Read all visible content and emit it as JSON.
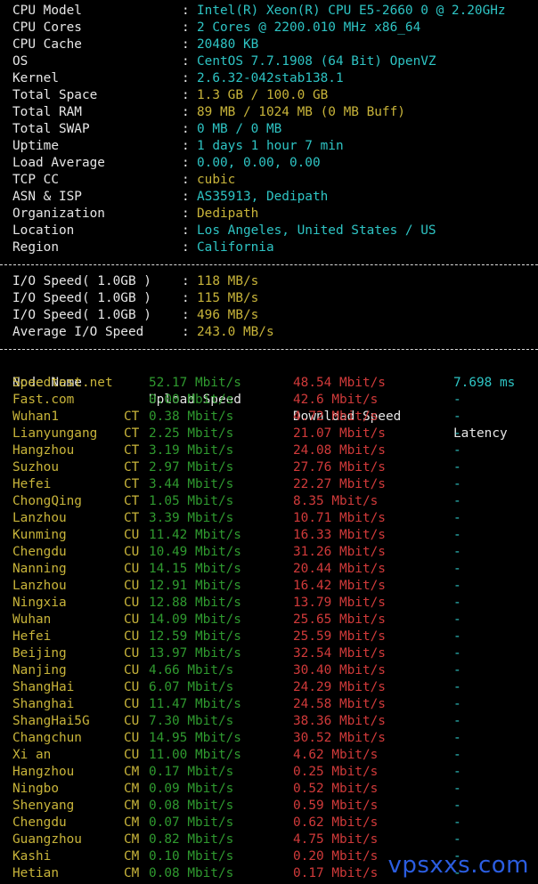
{
  "sysinfo": [
    {
      "key": "CPU Model",
      "value": "Intel(R) Xeon(R) CPU E5-2660 0 @ 2.20GHz",
      "color": "cyan"
    },
    {
      "key": "CPU Cores",
      "value": "2 Cores @ 2200.010 MHz x86_64",
      "color": "cyan"
    },
    {
      "key": "CPU Cache",
      "value": "20480 KB",
      "color": "cyan"
    },
    {
      "key": "OS",
      "value": "CentOS 7.7.1908 (64 Bit) OpenVZ",
      "color": "cyan"
    },
    {
      "key": "Kernel",
      "value": "2.6.32-042stab138.1",
      "color": "cyan"
    },
    {
      "key": "Total Space",
      "value": "1.3 GB / 100.0 GB",
      "color": "yellow"
    },
    {
      "key": "Total RAM",
      "value": "89 MB / 1024 MB (0 MB Buff)",
      "color": "yellow"
    },
    {
      "key": "Total SWAP",
      "value": "0 MB / 0 MB",
      "color": "cyan"
    },
    {
      "key": "Uptime",
      "value": "1 days 1 hour 7 min",
      "color": "cyan"
    },
    {
      "key": "Load Average",
      "value": "0.00, 0.00, 0.00",
      "color": "cyan"
    },
    {
      "key": "TCP CC",
      "value": "cubic",
      "color": "yellow"
    },
    {
      "key": "ASN & ISP",
      "value": "AS35913, Dedipath",
      "color": "cyan"
    },
    {
      "key": "Organization",
      "value": "Dedipath",
      "color": "yellow"
    },
    {
      "key": "Location",
      "value": "Los Angeles, United States / US",
      "color": "cyan"
    },
    {
      "key": "Region",
      "value": "California",
      "color": "cyan"
    }
  ],
  "io": [
    {
      "key": "I/O Speed( 1.0GB )",
      "value": "118 MB/s"
    },
    {
      "key": "I/O Speed( 1.0GB )",
      "value": "115 MB/s"
    },
    {
      "key": "I/O Speed( 1.0GB )",
      "value": "496 MB/s"
    },
    {
      "key": "Average I/O Speed",
      "value": "243.0 MB/s"
    }
  ],
  "colon": ":",
  "speed_header": {
    "node": "Node Name",
    "upload": "Upload Speed",
    "download": "Download Speed",
    "latency": "Latency"
  },
  "speed_rows": [
    {
      "node": "Speedtest.net",
      "isp": "",
      "up": "52.17 Mbit/s",
      "down": "48.54 Mbit/s",
      "lat": "7.698 ms"
    },
    {
      "node": "Fast.com",
      "isp": "",
      "up": "0.00 Mbit/s",
      "down": "42.6 Mbit/s",
      "lat": "-"
    },
    {
      "node": "Wuhan1",
      "isp": "CT",
      "up": "0.38 Mbit/s",
      "down": "4.72 Mbit/s",
      "lat": "-"
    },
    {
      "node": "Lianyungang",
      "isp": "CT",
      "up": "2.25 Mbit/s",
      "down": "21.07 Mbit/s",
      "lat": "-"
    },
    {
      "node": "Hangzhou",
      "isp": "CT",
      "up": "3.19 Mbit/s",
      "down": "24.08 Mbit/s",
      "lat": "-"
    },
    {
      "node": "Suzhou",
      "isp": "CT",
      "up": "2.97 Mbit/s",
      "down": "27.76 Mbit/s",
      "lat": "-"
    },
    {
      "node": "Hefei",
      "isp": "CT",
      "up": "3.44 Mbit/s",
      "down": "22.27 Mbit/s",
      "lat": "-"
    },
    {
      "node": "ChongQing",
      "isp": "CT",
      "up": "1.05 Mbit/s",
      "down": "8.35 Mbit/s",
      "lat": "-"
    },
    {
      "node": "Lanzhou",
      "isp": "CT",
      "up": "3.39 Mbit/s",
      "down": "10.71 Mbit/s",
      "lat": "-"
    },
    {
      "node": "Kunming",
      "isp": "CU",
      "up": "11.42 Mbit/s",
      "down": "16.33 Mbit/s",
      "lat": "-"
    },
    {
      "node": "Chengdu",
      "isp": "CU",
      "up": "10.49 Mbit/s",
      "down": "31.26 Mbit/s",
      "lat": "-"
    },
    {
      "node": "Nanning",
      "isp": "CU",
      "up": "14.15 Mbit/s",
      "down": "20.44 Mbit/s",
      "lat": "-"
    },
    {
      "node": "Lanzhou",
      "isp": "CU",
      "up": "12.91 Mbit/s",
      "down": "16.42 Mbit/s",
      "lat": "-"
    },
    {
      "node": "Ningxia",
      "isp": "CU",
      "up": "12.88 Mbit/s",
      "down": "13.79 Mbit/s",
      "lat": "-"
    },
    {
      "node": "Wuhan",
      "isp": "CU",
      "up": "14.09 Mbit/s",
      "down": "25.65 Mbit/s",
      "lat": "-"
    },
    {
      "node": "Hefei",
      "isp": "CU",
      "up": "12.59 Mbit/s",
      "down": "25.59 Mbit/s",
      "lat": "-"
    },
    {
      "node": "Beijing",
      "isp": "CU",
      "up": "13.97 Mbit/s",
      "down": "32.54 Mbit/s",
      "lat": "-"
    },
    {
      "node": "Nanjing",
      "isp": "CU",
      "up": "4.66 Mbit/s",
      "down": "30.40 Mbit/s",
      "lat": "-"
    },
    {
      "node": "ShangHai",
      "isp": "CU",
      "up": "6.07 Mbit/s",
      "down": "24.29 Mbit/s",
      "lat": "-"
    },
    {
      "node": "Shanghai",
      "isp": "CU",
      "up": "11.47 Mbit/s",
      "down": "24.58 Mbit/s",
      "lat": "-"
    },
    {
      "node": "ShangHai5G",
      "isp": "CU",
      "up": "7.30 Mbit/s",
      "down": "38.36 Mbit/s",
      "lat": "-"
    },
    {
      "node": "Changchun",
      "isp": "CU",
      "up": "14.95 Mbit/s",
      "down": "30.52 Mbit/s",
      "lat": "-"
    },
    {
      "node": "Xi an",
      "isp": "CU",
      "up": "11.00 Mbit/s",
      "down": "4.62 Mbit/s",
      "lat": "-"
    },
    {
      "node": "Hangzhou",
      "isp": "CM",
      "up": "0.17 Mbit/s",
      "down": "0.25 Mbit/s",
      "lat": "-"
    },
    {
      "node": "Ningbo",
      "isp": "CM",
      "up": "0.09 Mbit/s",
      "down": "0.52 Mbit/s",
      "lat": "-"
    },
    {
      "node": "Shenyang",
      "isp": "CM",
      "up": "0.08 Mbit/s",
      "down": "0.59 Mbit/s",
      "lat": "-"
    },
    {
      "node": "Chengdu",
      "isp": "CM",
      "up": "0.07 Mbit/s",
      "down": "0.62 Mbit/s",
      "lat": "-"
    },
    {
      "node": "Guangzhou",
      "isp": "CM",
      "up": "0.82 Mbit/s",
      "down": "4.75 Mbit/s",
      "lat": "-"
    },
    {
      "node": "Kashi",
      "isp": "CM",
      "up": "0.10 Mbit/s",
      "down": "0.20 Mbit/s",
      "lat": "-"
    },
    {
      "node": "Hetian",
      "isp": "CM",
      "up": "0.08 Mbit/s",
      "down": "0.17 Mbit/s",
      "lat": "-"
    }
  ],
  "watermark": "vpsxxs.com",
  "colors": {
    "background": "#000000",
    "cyan": "#2ec4c4",
    "yellow": "#c8b43a",
    "green": "#2f9a2f",
    "red": "#d13a3a",
    "watermark": "#2b5de0"
  }
}
